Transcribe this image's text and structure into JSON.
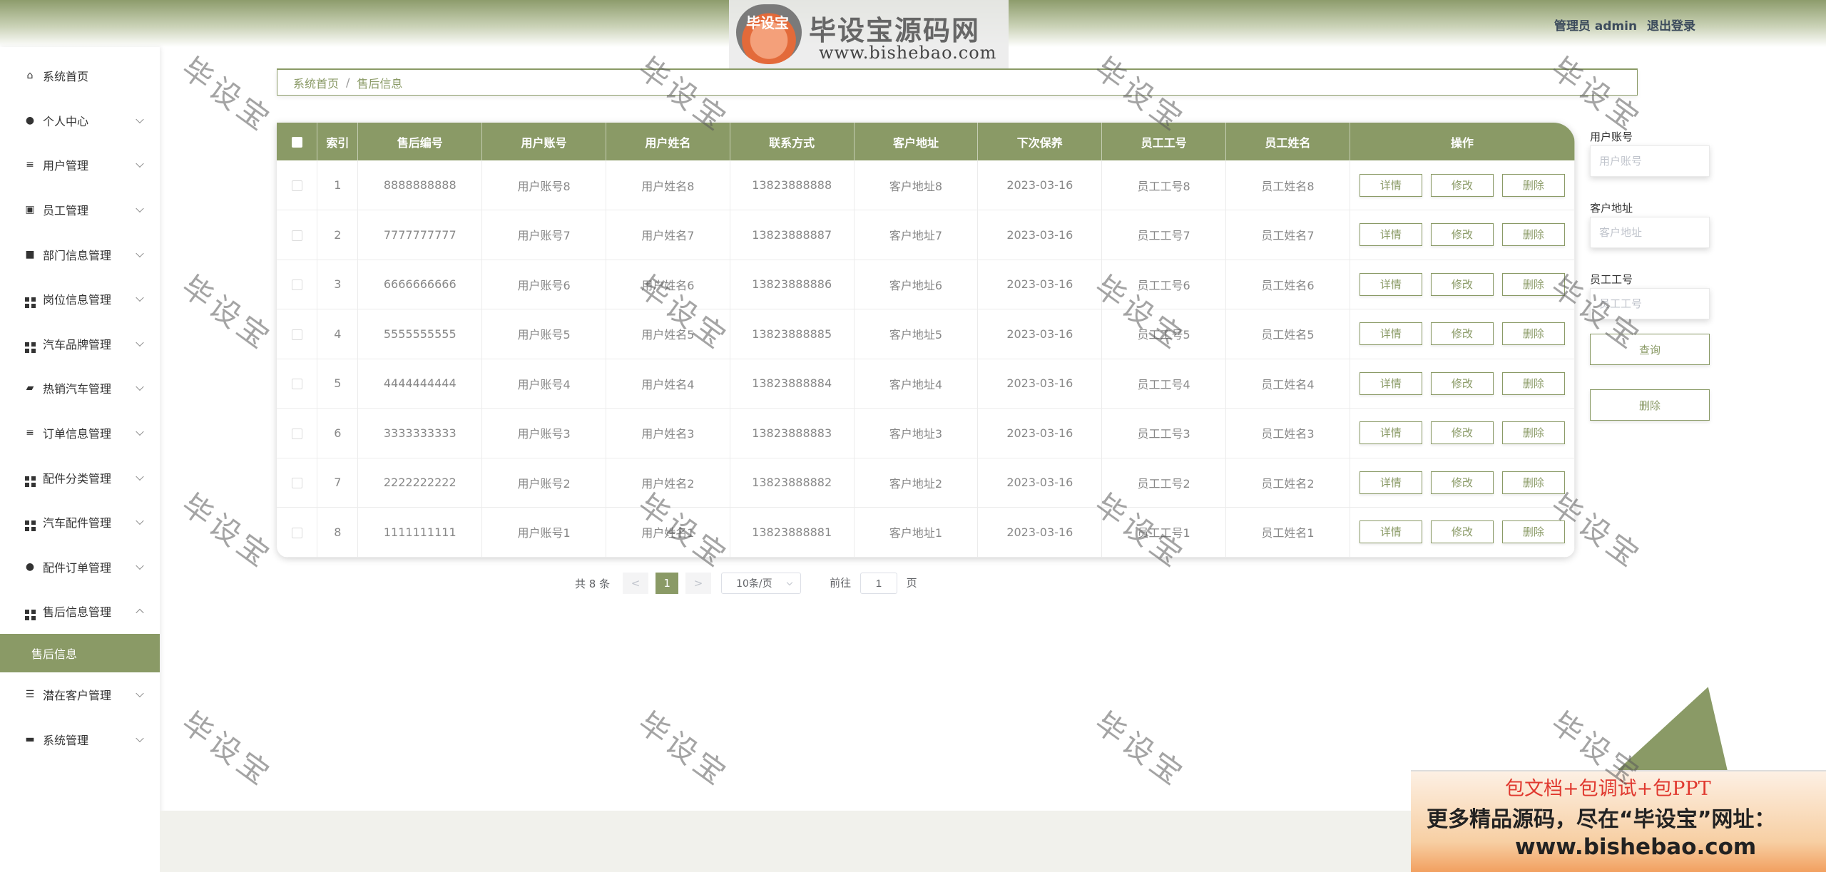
{
  "header": {
    "logo_badge": "毕设宝",
    "logo_title": "毕设宝源码网",
    "logo_url": "www.bishebao.com",
    "user_label": "管理员 admin",
    "logout_label": "退出登录"
  },
  "sidebar": {
    "items": [
      {
        "label": "系统首页",
        "icon": "home-icon"
      },
      {
        "label": "个人中心",
        "icon": "user-icon"
      },
      {
        "label": "用户管理",
        "icon": "list-icon"
      },
      {
        "label": "员工管理",
        "icon": "chart-icon"
      },
      {
        "label": "部门信息管理",
        "icon": "video-icon"
      },
      {
        "label": "岗位信息管理",
        "icon": "grid-icon"
      },
      {
        "label": "汽车品牌管理",
        "icon": "grid-icon"
      },
      {
        "label": "热销汽车管理",
        "icon": "chat-icon"
      },
      {
        "label": "订单信息管理",
        "icon": "list-icon"
      },
      {
        "label": "配件分类管理",
        "icon": "grid-icon"
      },
      {
        "label": "汽车配件管理",
        "icon": "grid-icon"
      },
      {
        "label": "配件订单管理",
        "icon": "location-icon"
      },
      {
        "label": "售后信息管理",
        "icon": "grid-icon"
      }
    ],
    "active_sub": "售后信息",
    "items_after": [
      {
        "label": "潜在客户管理",
        "icon": "sliders-icon"
      },
      {
        "label": "系统管理",
        "icon": "tag-icon"
      }
    ]
  },
  "breadcrumb": {
    "home": "系统首页",
    "sep": "/",
    "current": "售后信息"
  },
  "table": {
    "headers": [
      "索引",
      "售后编号",
      "用户账号",
      "用户姓名",
      "联系方式",
      "客户地址",
      "下次保养",
      "员工工号",
      "员工姓名",
      "操作"
    ],
    "rows": [
      {
        "index": "1",
        "code": "8888888888",
        "account": "用户账号8",
        "name": "用户姓名8",
        "phone": "13823888888",
        "address": "客户地址8",
        "next": "2023-03-16",
        "staff_no": "员工工号8",
        "staff_name": "员工姓名8"
      },
      {
        "index": "2",
        "code": "7777777777",
        "account": "用户账号7",
        "name": "用户姓名7",
        "phone": "13823888887",
        "address": "客户地址7",
        "next": "2023-03-16",
        "staff_no": "员工工号7",
        "staff_name": "员工姓名7"
      },
      {
        "index": "3",
        "code": "6666666666",
        "account": "用户账号6",
        "name": "用户姓名6",
        "phone": "13823888886",
        "address": "客户地址6",
        "next": "2023-03-16",
        "staff_no": "员工工号6",
        "staff_name": "员工姓名6"
      },
      {
        "index": "4",
        "code": "5555555555",
        "account": "用户账号5",
        "name": "用户姓名5",
        "phone": "13823888885",
        "address": "客户地址5",
        "next": "2023-03-16",
        "staff_no": "员工工号5",
        "staff_name": "员工姓名5"
      },
      {
        "index": "5",
        "code": "4444444444",
        "account": "用户账号4",
        "name": "用户姓名4",
        "phone": "13823888884",
        "address": "客户地址4",
        "next": "2023-03-16",
        "staff_no": "员工工号4",
        "staff_name": "员工姓名4"
      },
      {
        "index": "6",
        "code": "3333333333",
        "account": "用户账号3",
        "name": "用户姓名3",
        "phone": "13823888883",
        "address": "客户地址3",
        "next": "2023-03-16",
        "staff_no": "员工工号3",
        "staff_name": "员工姓名3"
      },
      {
        "index": "7",
        "code": "2222222222",
        "account": "用户账号2",
        "name": "用户姓名2",
        "phone": "13823888882",
        "address": "客户地址2",
        "next": "2023-03-16",
        "staff_no": "员工工号2",
        "staff_name": "员工姓名2"
      },
      {
        "index": "8",
        "code": "1111111111",
        "account": "用户账号1",
        "name": "用户姓名1",
        "phone": "13823888881",
        "address": "客户地址1",
        "next": "2023-03-16",
        "staff_no": "员工工号1",
        "staff_name": "员工姓名1"
      }
    ],
    "actions": {
      "detail": "详情",
      "edit": "修改",
      "delete": "删除"
    }
  },
  "pagination": {
    "total": "共 8 条",
    "prev": "<",
    "current_page": "1",
    "next": ">",
    "page_size": "10条/页",
    "goto_prefix": "前往",
    "goto_value": "1",
    "goto_suffix": "页"
  },
  "search": {
    "account_label": "用户账号",
    "account_placeholder": "用户账号",
    "address_label": "客户地址",
    "address_placeholder": "客户地址",
    "staff_label": "员工工号",
    "staff_placeholder": "员工工号",
    "query_label": "查询",
    "delete_label": "删除"
  },
  "watermark": "毕设宝",
  "ad": {
    "line1": "包文档+包调试+包PPT",
    "line2": "更多精品源码，尽在“毕设宝”网址：",
    "line3": "www.bishebao.com"
  },
  "colors": {
    "accent": "#8a9a66",
    "header_top": "#8d9c6c",
    "ad_red": "#e0392f"
  }
}
